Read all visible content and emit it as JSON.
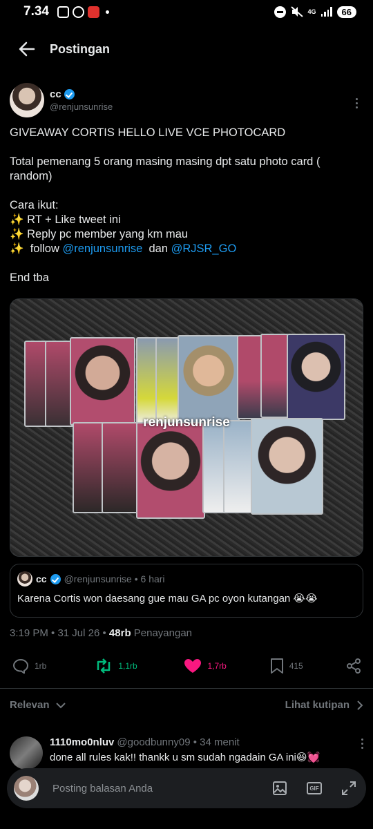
{
  "status_bar": {
    "time": "7.34",
    "network": "4G",
    "battery": "66"
  },
  "header": {
    "title": "Postingan"
  },
  "post": {
    "author_name": "cc",
    "author_handle": "@renjunsunrise",
    "title_line": "GIVEAWAY CORTIS HELLO LIVE VCE PHOTOCARD",
    "para2": "Total pemenang 5 orang masing masing dpt satu photo card ( random)",
    "cara": "Cara ikut:",
    "step1": "✨ RT + Like tweet ini",
    "step2": "✨ Reply pc member yang km mau",
    "step3_prefix": "✨  follow ",
    "step3_mention1": "@renjunsunrise",
    "step3_mid": "  dan ",
    "step3_mention2": "@RJSR_GO",
    "end": "End tba",
    "watermark": "renjunsunrise"
  },
  "quote": {
    "name": "cc",
    "meta": "@renjunsunrise • 6 hari",
    "text": "Karena Cortis won daesang gue mau GA pc oyon kutangan 😭😭"
  },
  "meta": {
    "time": "3:19 PM • 31 Jul 26 • ",
    "views_count": "48rb",
    "views_label": " Penayangan"
  },
  "actions": {
    "replies": "1rb",
    "retweets": "1,1rb",
    "likes": "1,7rb",
    "bookmarks": "415"
  },
  "filter": {
    "left": "Relevan",
    "right": "Lihat kutipan"
  },
  "reply": {
    "name": "1110mo0nluv",
    "meta": "@goodbunny09 • 34 menit",
    "text": "done all rules kak!! thankk u sm sudah ngadain GA ini😆💓"
  },
  "composer": {
    "placeholder": "Posting balasan Anda"
  },
  "colors": {
    "accent": "#1d9bf0",
    "retweet": "#00ba7c",
    "like": "#f91880",
    "muted": "#71767b"
  },
  "icons": [
    "back-arrow-icon",
    "verified-icon",
    "more-icon",
    "reply-icon",
    "retweet-icon",
    "heart-icon",
    "bookmark-icon",
    "share-icon",
    "chevron-down-icon",
    "chevron-right-icon",
    "image-icon",
    "gif-icon",
    "expand-icon"
  ]
}
